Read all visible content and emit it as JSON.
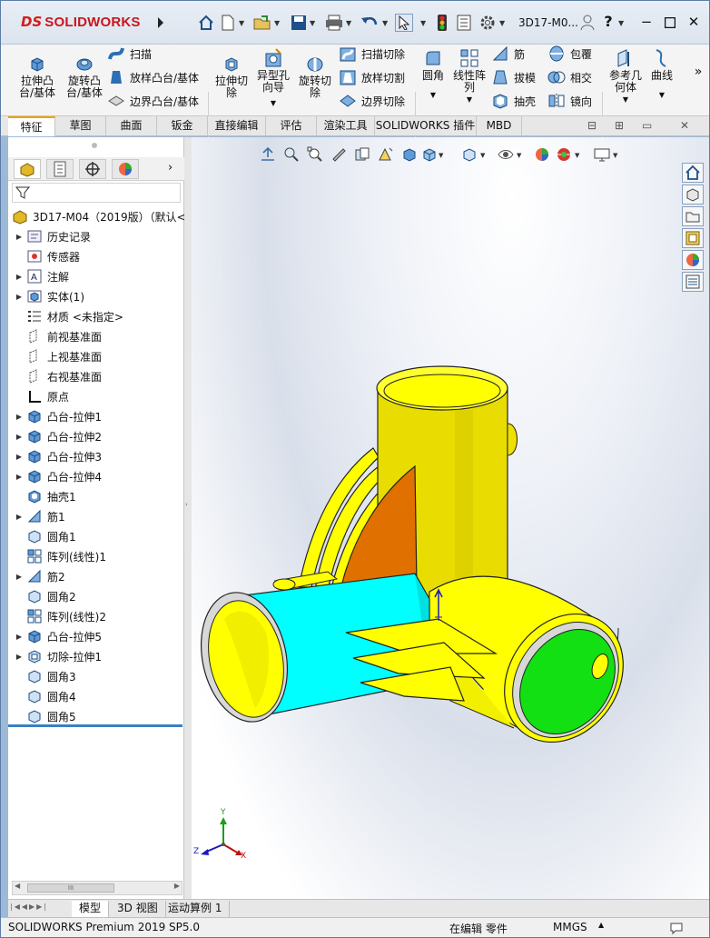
{
  "app": {
    "brand_prefix": "DS",
    "brand_name": "SOLIDWORKS",
    "document_title": "3D17-M0...",
    "colors": {
      "brand": "#c8161d",
      "accent_tab": "#f0a000",
      "selection_blue": "#3b7fc4"
    }
  },
  "toolbar": {
    "icons": [
      "home-icon",
      "new-document-icon",
      "open-icon",
      "save-icon",
      "print-icon",
      "undo-icon",
      "select-icon",
      "traffic-light-icon",
      "options-list-icon",
      "gear-icon",
      "user-icon",
      "help-icon"
    ],
    "help": "?"
  },
  "command_manager": {
    "extrude_boss": "拉伸凸\n台/基体",
    "revolve_boss": "旋转凸\n台/基体",
    "sweep": "扫描",
    "loft": "放样凸台/基体",
    "boundary_boss": "边界凸台/基体",
    "extrude_cut": "拉伸切\n除",
    "hole_wizard": "异型孔\n向导",
    "revolve_cut": "旋转切\n除",
    "swept_cut": "扫描切除",
    "lofted_cut": "放样切割",
    "boundary_cut": "边界切除",
    "fillet": "圆角",
    "linear_pattern": "线性阵\n列",
    "rib": "筋",
    "draft": "拔模",
    "shell": "抽壳",
    "wrap": "包覆",
    "intersect": "相交",
    "mirror": "镜向",
    "ref_geometry": "参考几\n何体",
    "curves": "曲线",
    "more": "»"
  },
  "tabs": [
    "特征",
    "草图",
    "曲面",
    "钣金",
    "直接编辑",
    "评估",
    "渲染工具",
    "SOLIDWORKS 插件",
    "MBD"
  ],
  "feature_manager": {
    "root": "3D17-M04（2019版）（默认<",
    "items": [
      {
        "label": "历史记录",
        "icon": "history-icon",
        "expandable": true
      },
      {
        "label": "传感器",
        "icon": "sensor-icon",
        "expandable": false
      },
      {
        "label": "注解",
        "icon": "annotation-icon",
        "expandable": true
      },
      {
        "label": "实体(1)",
        "icon": "solid-body-icon",
        "expandable": true
      },
      {
        "label": "材质 <未指定>",
        "icon": "material-icon",
        "expandable": false
      },
      {
        "label": "前视基准面",
        "icon": "plane-icon",
        "expandable": false
      },
      {
        "label": "上视基准面",
        "icon": "plane-icon",
        "expandable": false
      },
      {
        "label": "右视基准面",
        "icon": "plane-icon",
        "expandable": false
      },
      {
        "label": "原点",
        "icon": "origin-icon",
        "expandable": false
      },
      {
        "label": "凸台-拉伸1",
        "icon": "extrude-icon",
        "expandable": true
      },
      {
        "label": "凸台-拉伸2",
        "icon": "extrude-icon",
        "expandable": true
      },
      {
        "label": "凸台-拉伸3",
        "icon": "extrude-icon",
        "expandable": true
      },
      {
        "label": "凸台-拉伸4",
        "icon": "extrude-icon",
        "expandable": true
      },
      {
        "label": "抽壳1",
        "icon": "shell-icon",
        "expandable": false
      },
      {
        "label": "筋1",
        "icon": "rib-icon",
        "expandable": true
      },
      {
        "label": "圆角1",
        "icon": "fillet-icon",
        "expandable": false
      },
      {
        "label": "阵列(线性)1",
        "icon": "pattern-icon",
        "expandable": false
      },
      {
        "label": "筋2",
        "icon": "rib-icon",
        "expandable": true
      },
      {
        "label": "圆角2",
        "icon": "fillet-icon",
        "expandable": false
      },
      {
        "label": "阵列(线性)2",
        "icon": "pattern-icon",
        "expandable": false
      },
      {
        "label": "凸台-拉伸5",
        "icon": "extrude-icon",
        "expandable": true
      },
      {
        "label": "切除-拉伸1",
        "icon": "cut-extrude-icon",
        "expandable": true
      },
      {
        "label": "圆角3",
        "icon": "fillet-icon",
        "expandable": false
      },
      {
        "label": "圆角4",
        "icon": "fillet-icon",
        "expandable": false
      },
      {
        "label": "圆角5",
        "icon": "fillet-icon",
        "expandable": false
      }
    ],
    "scroll_thumb": "III"
  },
  "bottom_tabs": [
    "模型",
    "3D 视图",
    "运动算例 1"
  ],
  "status": {
    "product": "SOLIDWORKS Premium 2019 SP5.0",
    "mode": "在编辑 零件",
    "units": "MMGS"
  },
  "triad": {
    "x": "X",
    "y": "Y",
    "z": "Z"
  }
}
